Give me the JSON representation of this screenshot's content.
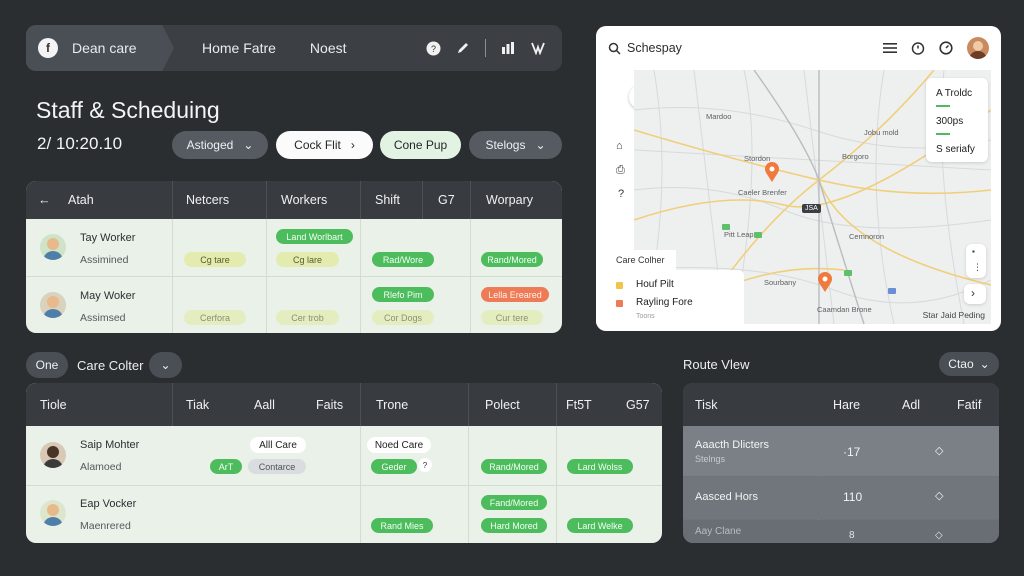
{
  "topbar": {
    "logo_glyph": "f",
    "crumbs": [
      "Dean care",
      "Home Fatre",
      "Noest"
    ]
  },
  "page": {
    "title": "Staff & Scheduing",
    "datetime": "2/ 10:20.10"
  },
  "filters": [
    {
      "label": "Astioged",
      "style": "dark",
      "chevron": "⌄"
    },
    {
      "label": "Cock Flit",
      "style": "white",
      "chevron": "›"
    },
    {
      "label": "Cone Pup",
      "style": "mint"
    },
    {
      "label": "Stelogs",
      "style": "dark",
      "chevron": "⌄"
    }
  ],
  "staff_table": {
    "columns": [
      "Atah",
      "Netcers",
      "Workers",
      "Shift",
      "G7",
      "Worpary"
    ],
    "back_glyph": "←",
    "rows": [
      {
        "name": "Tay Worker",
        "status": "Assimined",
        "tags": [
          "Cg tare",
          "Land Worlbart",
          "Cg lare",
          "Rad/Wore",
          "Rand/Mored"
        ]
      },
      {
        "name": "May Woker",
        "status": "Assimsed",
        "tags": [
          "Cerfora",
          "Rlefo Pim",
          "Cer trob",
          "Lella Ereared",
          "Cor Dogs",
          "Cur tere"
        ]
      }
    ]
  },
  "map": {
    "search_label": "Schespay",
    "legend_top": [
      "A Troldc",
      "300ps",
      "S seriafy"
    ],
    "labels": [
      "Mardoo",
      "Stordon",
      "Borgoro",
      "Caeler Brenfer",
      "Cemnoron",
      "Pitt Leap",
      "Sourbany",
      "Caamdan Brone",
      "Jobu mold"
    ],
    "route_badge": "JSA",
    "card_title": "Care Colher",
    "legend_items": [
      {
        "label": "Houf Pilt",
        "color": "#f0c64a"
      },
      {
        "label": "Rayling Fore",
        "color": "#ef7a56"
      }
    ],
    "legend_note": "Toons",
    "footer": "Star Jaid Peding",
    "controls": [
      "+",
      "◎"
    ],
    "side_icons": [
      "⌂",
      "⎙",
      "?"
    ],
    "right_controls": [
      "▪",
      "⋮",
      "›"
    ]
  },
  "bottom_filter": {
    "chip": "One",
    "label": "Care Colter",
    "chevron": "⌄"
  },
  "schedule_table": {
    "columns": [
      "Tiole",
      "Tiak",
      "Aall",
      "Faits",
      "Trone",
      "Polect",
      "Ft5T",
      "G57"
    ],
    "rows": [
      {
        "name": "Saip Mohter",
        "status": "Alamoed",
        "tags": [
          "Alll Care",
          "ArT",
          "Contarce",
          "Noed Care",
          "Geder",
          "Rand/Mored",
          "Lard Wolss"
        ]
      },
      {
        "name": "Eap Vocker",
        "status": "Maenrered",
        "tags": [
          "Fand/Mored",
          "Rand Mies",
          "Hard Mored",
          "Lard Welke"
        ]
      }
    ]
  },
  "route": {
    "title": "Route Vlew",
    "dropdown": "Ctao",
    "columns": [
      "Tisk",
      "Hare",
      "Adl",
      "Fatif"
    ],
    "rows": [
      {
        "name": "Aaacth Dlicters",
        "sub": "Stelngs",
        "value": "·17",
        "mark": "◇"
      },
      {
        "name": "Aasced Hors",
        "sub": "",
        "value": "110",
        "mark": "◇"
      },
      {
        "name": "Aay Clane",
        "sub": "",
        "value": "8",
        "mark": "◇"
      }
    ]
  }
}
